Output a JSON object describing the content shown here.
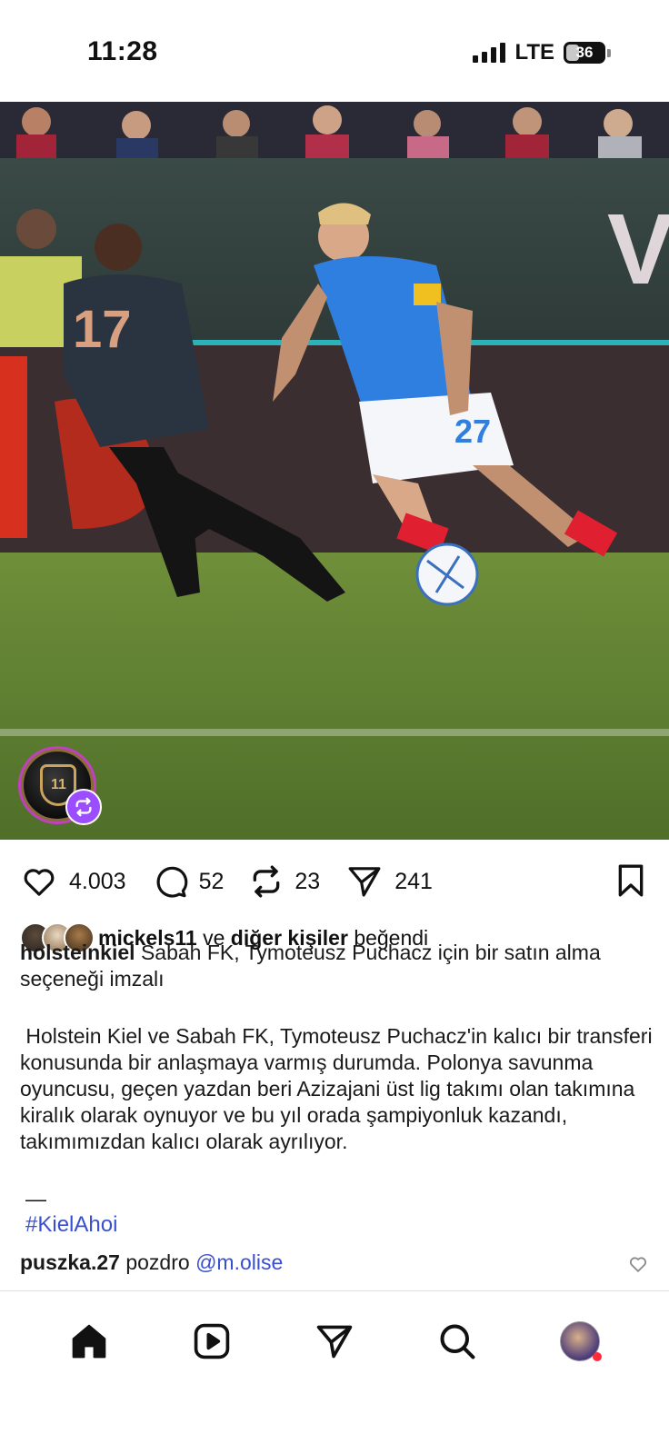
{
  "status_bar": {
    "time": "11:28",
    "network": "LTE",
    "battery": "36",
    "battery_level": 0.36
  },
  "post": {
    "image_subject": "football match photo: player in blue shirt number 27 dribbling against player in dark shirt number 17",
    "avatar_icon": "club-crest-icon",
    "repost_icon": "repost-icon",
    "actions": {
      "likes": "4.003",
      "comments": "52",
      "reposts": "23",
      "shares": "241"
    },
    "liked_by": {
      "user": "mickels11",
      "connector": "ve",
      "others": "diğer kişiler",
      "suffix": "beğendi"
    },
    "caption": {
      "author": "holsteinkiel",
      "headline": "Sabah FK, Tymoteusz Puchacz için bir satın alma seçeneği imzalı",
      "body": "Holstein Kiel ve Sabah FK, Tymoteusz Puchacz'in kalıcı bir transferi konusunda bir anlaşmaya varmış durumda. Polonya savunma oyuncusu, geçen yazdan beri Azizajani üst lig takımı olan takımına kiralık olarak oynuyor ve bu yıl orada şampiyonluk kazandı, takımımızdan kalıcı olarak ayrılıyor.",
      "dash": "—",
      "hashtag": "#KielAhoi"
    },
    "top_comment": {
      "user": "puszka.27",
      "text": "pozdro",
      "mention": "@m.olise"
    }
  },
  "colors": {
    "accent_link": "#3a4fd0",
    "repost_badge": "#9b4dff",
    "notification_dot": "#ff2a3a"
  },
  "nav": {
    "items": [
      "home-icon",
      "reels-icon",
      "send-icon",
      "search-icon",
      "profile-avatar"
    ]
  }
}
